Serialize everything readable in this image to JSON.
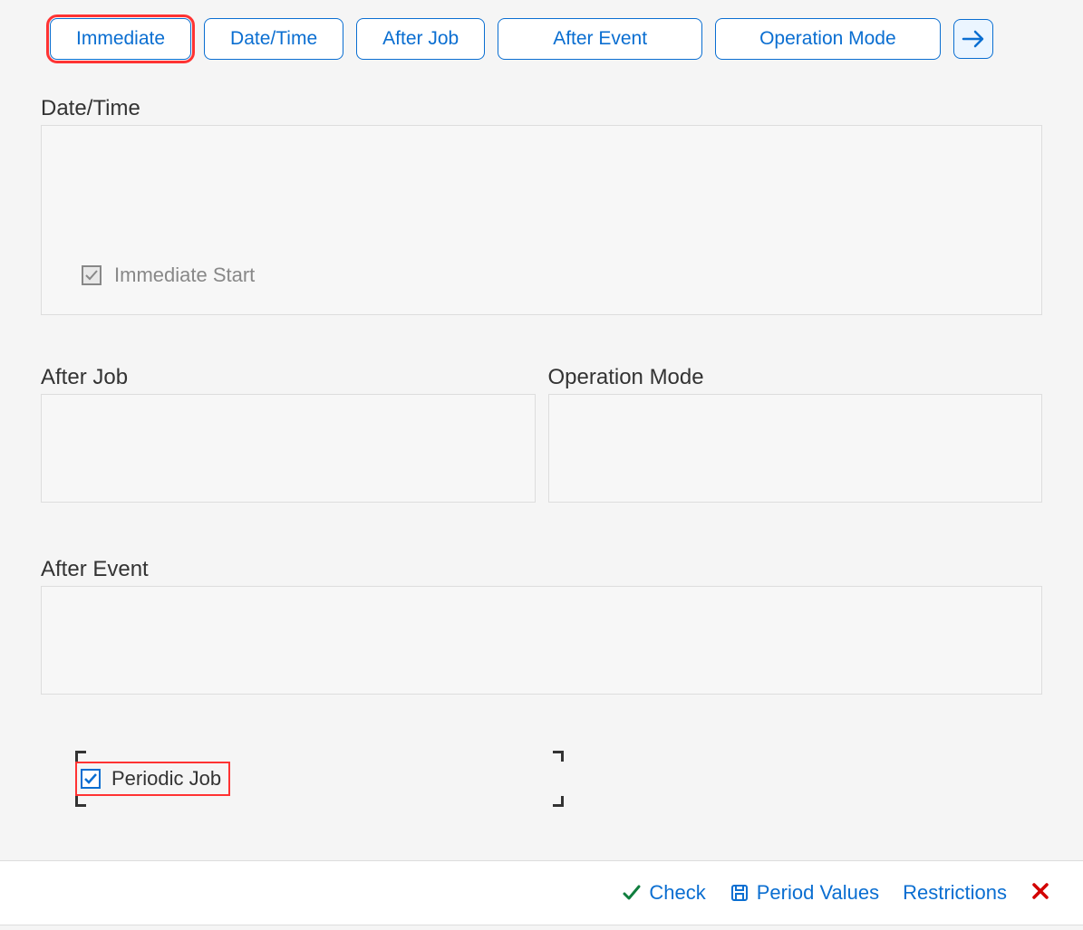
{
  "topButtons": {
    "immediate": "Immediate",
    "dateTime": "Date/Time",
    "afterJob": "After Job",
    "afterEvent": "After Event",
    "operationMode": "Operation Mode"
  },
  "sections": {
    "dateTime": {
      "label": "Date/Time",
      "checkbox": {
        "label": "Immediate Start",
        "checked": true
      }
    },
    "afterJob": {
      "label": "After Job"
    },
    "operationMode": {
      "label": "Operation Mode"
    },
    "afterEvent": {
      "label": "After Event"
    }
  },
  "periodicJob": {
    "label": "Periodic Job",
    "checked": true
  },
  "footer": {
    "check": "Check",
    "periodValues": "Period Values",
    "restrictions": "Restrictions"
  }
}
